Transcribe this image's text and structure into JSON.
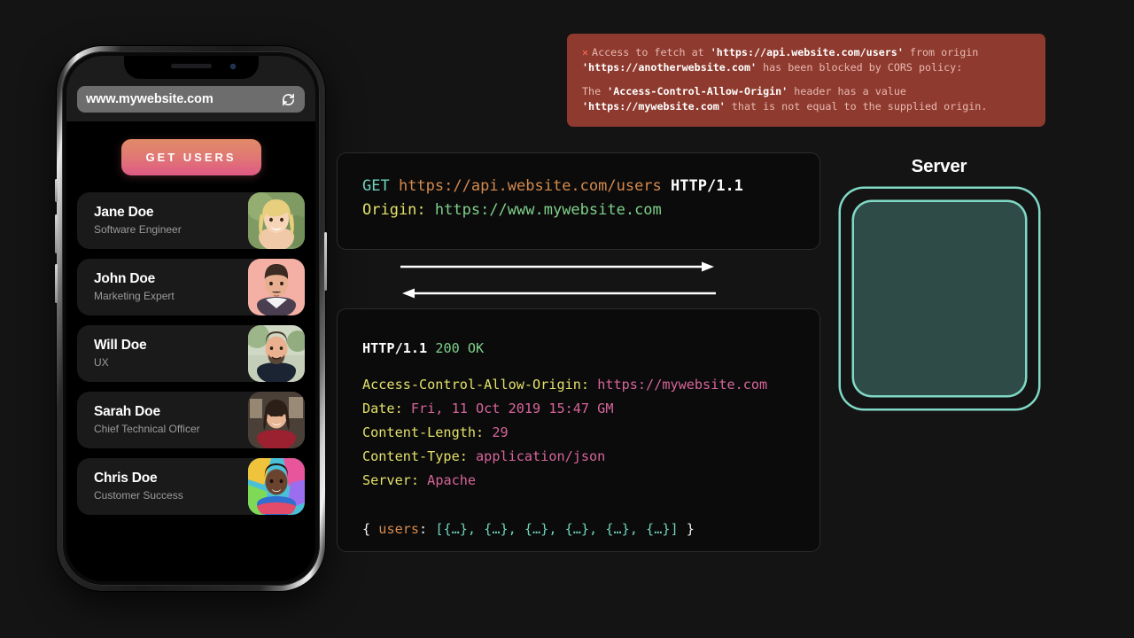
{
  "phone": {
    "browser": {
      "url": "www.mywebsite.com",
      "reload_icon": "reload-icon"
    },
    "get_users_button": "GET USERS",
    "users": [
      {
        "name": "Jane Doe",
        "role": "Software Engineer"
      },
      {
        "name": "John Doe",
        "role": "Marketing Expert"
      },
      {
        "name": "Will Doe",
        "role": "UX"
      },
      {
        "name": "Sarah Doe",
        "role": "Chief Technical Officer"
      },
      {
        "name": "Chris Doe",
        "role": "Customer Success"
      }
    ]
  },
  "cors_error": {
    "x_icon": "error-x-icon",
    "line1_a": "Access to fetch at ",
    "line1_url": "'https://api.website.com/users'",
    "line1_b": " from origin",
    "line2_origin": "'https://anotherwebsite.com'",
    "line2_b": " has been blocked by CORS policy:",
    "line3_a": "The ",
    "line3_header": "'Access-Control-Allow-Origin'",
    "line3_b": " header has a value",
    "line4_value": "'https://mywebsite.com'",
    "line4_b": " that is not equal to the supplied origin."
  },
  "request": {
    "method": "GET",
    "url": "https://api.website.com/users",
    "protocol": "HTTP/1.1",
    "origin_key": "Origin:",
    "origin_value": "https://www.mywebsite.com"
  },
  "response": {
    "status_proto": "HTTP/1.1",
    "status_code": "200 OK",
    "headers": [
      {
        "key": "Access-Control-Allow-Origin:",
        "value": "https://mywebsite.com"
      },
      {
        "key": "Date:",
        "value": "Fri, 11 Oct 2019 15:47 GM"
      },
      {
        "key": "Content-Length:",
        "value": "29"
      },
      {
        "key": "Content-Type:",
        "value": "application/json"
      },
      {
        "key": "Server:",
        "value": "Apache"
      }
    ],
    "body_open": "{ ",
    "body_key": "users",
    "body_colon": ": ",
    "body_array": "[{…}, {…}, {…}, {…}, {…}, {…}]",
    "body_close": " }"
  },
  "server": {
    "title": "Server"
  },
  "arrows": {
    "request_arrow": "arrow-right",
    "response_arrow": "arrow-left"
  },
  "colors": {
    "background": "#141414",
    "error_bg": "#8f3a2e",
    "accent_teal": "#7fd9c4",
    "button_gradient_top": "#e18a68",
    "button_gradient_bottom": "#df5a84"
  }
}
